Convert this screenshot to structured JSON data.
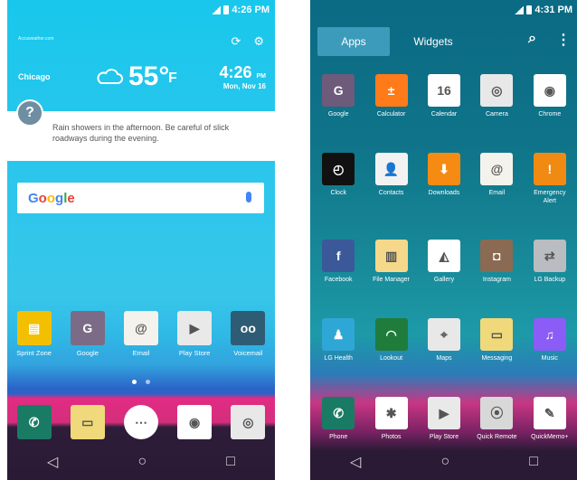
{
  "left": {
    "status_time": "4:26 PM",
    "weather": {
      "source": "Accuweather.com",
      "city": "Chicago",
      "temp": "55°",
      "unit": "F",
      "time": "4:26",
      "ampm": "PM",
      "date": "Mon, Nov 16",
      "forecast": "Rain showers in the afternoon. Be careful of slick roadways during the evening."
    },
    "search": {
      "logo": "Google"
    },
    "dock_apps": [
      {
        "label": "Sprint Zone",
        "icon": "sprint-icon",
        "color": "#f2c000"
      },
      {
        "label": "Google",
        "icon": "google-folder-icon",
        "color": "#7c6b86"
      },
      {
        "label": "Email",
        "icon": "email-icon",
        "color": "#f4f2ec"
      },
      {
        "label": "Play Store",
        "icon": "play-store-icon",
        "color": "#e9e9e9"
      },
      {
        "label": "Voicemail",
        "icon": "voicemail-icon",
        "color": "#2f5c75"
      }
    ],
    "hotseat": [
      {
        "icon": "phone-icon",
        "color": "#1a7b65"
      },
      {
        "icon": "messaging-icon",
        "color": "#f0d97a"
      },
      {
        "icon": "apps-icon",
        "color": "#ffffff"
      },
      {
        "icon": "chrome-icon",
        "color": "#ffffff"
      },
      {
        "icon": "camera-icon",
        "color": "#e8e8e8"
      }
    ]
  },
  "right": {
    "status_time": "4:31 PM",
    "tabs": [
      "Apps",
      "Widgets"
    ],
    "apps": [
      {
        "label": "Google",
        "icon": "google-folder-icon",
        "color": "#6e5a7a"
      },
      {
        "label": "Calculator",
        "icon": "calculator-icon",
        "color": "#ff7b1a"
      },
      {
        "label": "Calendar",
        "icon": "calendar-icon",
        "color": "#ffffff"
      },
      {
        "label": "Camera",
        "icon": "camera-icon",
        "color": "#e8e8e8"
      },
      {
        "label": "Chrome",
        "icon": "chrome-icon",
        "color": "#ffffff"
      },
      {
        "label": "Clock",
        "icon": "clock-icon",
        "color": "#111111"
      },
      {
        "label": "Contacts",
        "icon": "contacts-icon",
        "color": "#f2f2f2"
      },
      {
        "label": "Downloads",
        "icon": "downloads-icon",
        "color": "#f58b12"
      },
      {
        "label": "Email",
        "icon": "email-icon",
        "color": "#f4f2ec"
      },
      {
        "label": "Emergency Alert",
        "icon": "alert-icon",
        "color": "#f08a13"
      },
      {
        "label": "Facebook",
        "icon": "facebook-icon",
        "color": "#3b5998"
      },
      {
        "label": "File Manager",
        "icon": "folder-icon",
        "color": "#f5d88a"
      },
      {
        "label": "Gallery",
        "icon": "gallery-icon",
        "color": "#ffffff"
      },
      {
        "label": "Instagram",
        "icon": "instagram-icon",
        "color": "#8a6a52"
      },
      {
        "label": "LG Backup",
        "icon": "backup-icon",
        "color": "#b9bcc0"
      },
      {
        "label": "LG Health",
        "icon": "health-icon",
        "color": "#2fa7d6"
      },
      {
        "label": "Lookout",
        "icon": "lookout-icon",
        "color": "#1f7c3b"
      },
      {
        "label": "Maps",
        "icon": "maps-icon",
        "color": "#e8e8e8"
      },
      {
        "label": "Messaging",
        "icon": "messaging-icon",
        "color": "#f0d97a"
      },
      {
        "label": "Music",
        "icon": "music-icon",
        "color": "#8b5cf6"
      },
      {
        "label": "Phone",
        "icon": "phone-icon",
        "color": "#1a7b65"
      },
      {
        "label": "Photos",
        "icon": "photos-icon",
        "color": "#ffffff"
      },
      {
        "label": "Play Store",
        "icon": "play-store-icon",
        "color": "#e9e9e9"
      },
      {
        "label": "Quick Remote",
        "icon": "remote-icon",
        "color": "#d8d8d8"
      },
      {
        "label": "QuickMemo+",
        "icon": "memo-icon",
        "color": "#ffffff"
      }
    ]
  }
}
